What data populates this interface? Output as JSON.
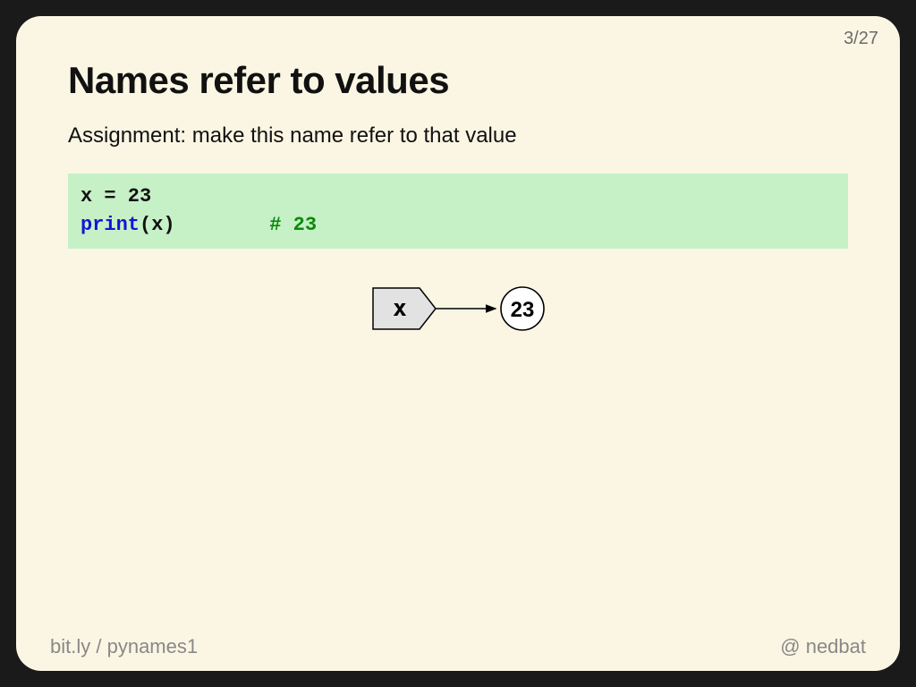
{
  "page": {
    "current": 3,
    "total": 27,
    "counter": "3/27"
  },
  "title": "Names refer to values",
  "subtitle": "Assignment: make this name refer to that value",
  "code": {
    "line1_pre": "x = 23",
    "line2_builtin": "print",
    "line2_call": "(x)",
    "line2_pad": "        ",
    "line2_comment": "# 23"
  },
  "diagram": {
    "name_label": "x",
    "value_label": "23"
  },
  "footer": {
    "left_host": "bit.ly",
    "left_sep": " / ",
    "left_path": "pynames1",
    "right_at": "@",
    "right_handle": " nedbat"
  }
}
